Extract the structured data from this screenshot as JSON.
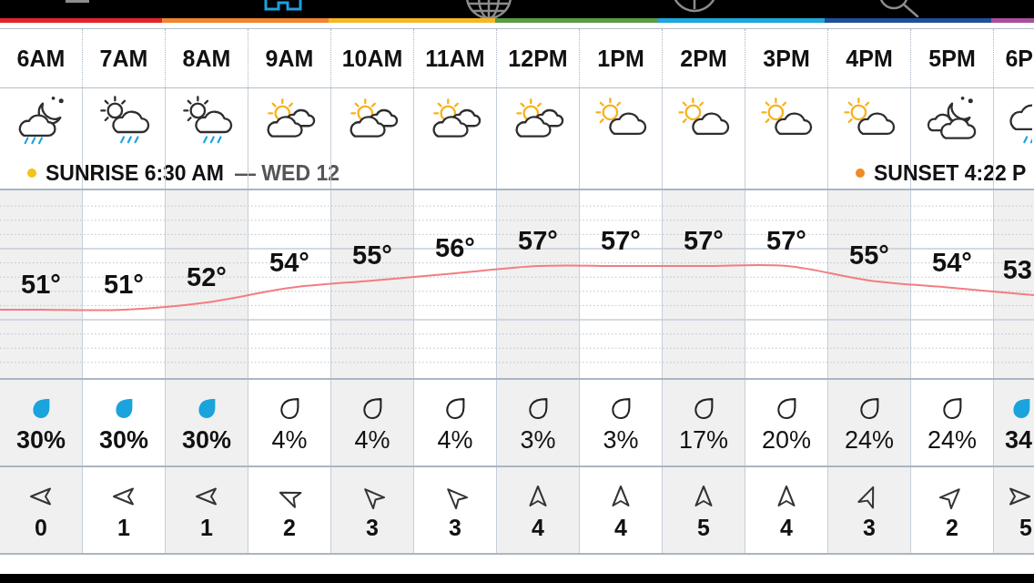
{
  "nav_tabs": [
    {
      "kind": "menu",
      "selected": false
    },
    {
      "kind": "home",
      "selected": true
    },
    {
      "kind": "globe",
      "selected": false
    },
    {
      "kind": "target",
      "selected": false
    },
    {
      "kind": "search",
      "selected": false
    }
  ],
  "hours": [
    {
      "time": "6AM",
      "weather": {
        "kind": "night-rain"
      },
      "event": {
        "label": "SUNRISE 6:30 AM",
        "note": "— WED 12",
        "color": "#f7c21a"
      },
      "temperature": "51°",
      "precip": {
        "chance": "30%",
        "kind": "likely"
      },
      "wind": {
        "speed": "0",
        "kind": "west"
      }
    },
    {
      "time": "7AM",
      "weather": {
        "kind": "sun-rain"
      },
      "temperature": "51°",
      "precip": {
        "chance": "30%",
        "kind": "likely"
      },
      "wind": {
        "speed": "1",
        "kind": "west"
      }
    },
    {
      "time": "8AM",
      "weather": {
        "kind": "sun-rain"
      },
      "temperature": "52°",
      "precip": {
        "chance": "30%",
        "kind": "likely"
      },
      "wind": {
        "speed": "1",
        "kind": "west"
      }
    },
    {
      "time": "9AM",
      "weather": {
        "kind": "sun-clouds"
      },
      "temperature": "54°",
      "precip": {
        "chance": "4%",
        "kind": "unlikely"
      },
      "wind": {
        "speed": "2",
        "kind": "west-northwest"
      }
    },
    {
      "time": "10AM",
      "weather": {
        "kind": "sun-clouds"
      },
      "temperature": "55°",
      "precip": {
        "chance": "4%",
        "kind": "unlikely"
      },
      "wind": {
        "speed": "3",
        "kind": "northwest"
      }
    },
    {
      "time": "11AM",
      "weather": {
        "kind": "sun-clouds"
      },
      "temperature": "56°",
      "precip": {
        "chance": "4%",
        "kind": "unlikely"
      },
      "wind": {
        "speed": "3",
        "kind": "northwest"
      }
    },
    {
      "time": "12PM",
      "weather": {
        "kind": "sun-clouds"
      },
      "temperature": "57°",
      "precip": {
        "chance": "3%",
        "kind": "unlikely"
      },
      "wind": {
        "speed": "4",
        "kind": "north"
      }
    },
    {
      "time": "1PM",
      "weather": {
        "kind": "sun-cloud"
      },
      "temperature": "57°",
      "precip": {
        "chance": "3%",
        "kind": "unlikely"
      },
      "wind": {
        "speed": "4",
        "kind": "north"
      }
    },
    {
      "time": "2PM",
      "weather": {
        "kind": "sun-cloud"
      },
      "temperature": "57°",
      "precip": {
        "chance": "17%",
        "kind": "unlikely"
      },
      "wind": {
        "speed": "5",
        "kind": "north"
      }
    },
    {
      "time": "3PM",
      "weather": {
        "kind": "sun-cloud"
      },
      "temperature": "57°",
      "precip": {
        "chance": "20%",
        "kind": "unlikely"
      },
      "wind": {
        "speed": "4",
        "kind": "north"
      }
    },
    {
      "time": "4PM",
      "weather": {
        "kind": "sun-cloud"
      },
      "event": {
        "label": "SUNSET 4:22 P",
        "color": "#f08a24"
      },
      "temperature": "55°",
      "precip": {
        "chance": "24%",
        "kind": "unlikely"
      },
      "wind": {
        "speed": "3",
        "kind": "north-northeast"
      }
    },
    {
      "time": "5PM",
      "weather": {
        "kind": "moon-clouds"
      },
      "temperature": "54°",
      "precip": {
        "chance": "24%",
        "kind": "unlikely"
      },
      "wind": {
        "speed": "2",
        "kind": "northeast"
      }
    },
    {
      "time": "6P",
      "weather": {
        "kind": "rain"
      },
      "temperature": "53",
      "precip": {
        "chance": "34",
        "kind": "likely"
      },
      "wind": {
        "speed": "5",
        "kind": "east"
      }
    }
  ]
}
